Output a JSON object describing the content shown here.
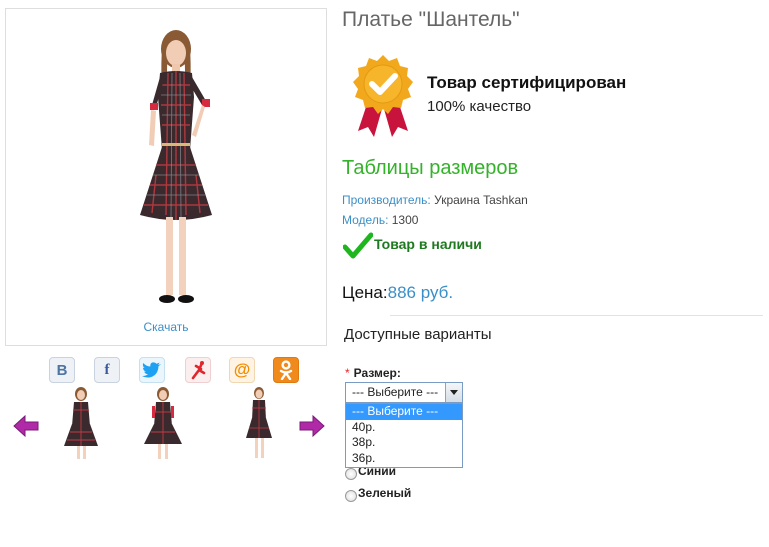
{
  "product": {
    "title": "Платье \"Шантель\"",
    "download_label": "Скачать"
  },
  "social": {
    "icons": [
      "vk-icon",
      "facebook-icon",
      "twitter-icon",
      "ya-icon",
      "mail-ru-icon",
      "odnoklassniki-icon"
    ],
    "vk_glyph": "В",
    "fb_glyph": "f",
    "ml_glyph": "@",
    "ok_glyph": "ок"
  },
  "certificate": {
    "title": "Товар сертифицирован",
    "subtitle": "100% качество"
  },
  "details": {
    "size_table_link": "Таблицы размеров",
    "manufacturer_key": "Производитель:",
    "manufacturer_value": "Украина Tashkan",
    "model_key": "Модель:",
    "model_value": "1300",
    "stock": "Товар в наличи"
  },
  "price": {
    "label": "Цена:",
    "value": "886 руб."
  },
  "variants": {
    "heading": "Доступные варианты",
    "size_required_mark": "*",
    "size_label": "Размер:",
    "select_value": "--- Выберите ---",
    "options": [
      "--- Выберите ---",
      "40р.",
      "38р.",
      "36р."
    ],
    "colors": [
      "Синий",
      "Зеленый"
    ]
  },
  "colors": {
    "accent_blue": "#3a8fc8",
    "green_link": "#33b22a",
    "stock_green": "#1e7a1e",
    "badge_gold": "#f2a81d",
    "ribbon_red": "#c8143c",
    "nav_arrow": "#a0219b"
  }
}
